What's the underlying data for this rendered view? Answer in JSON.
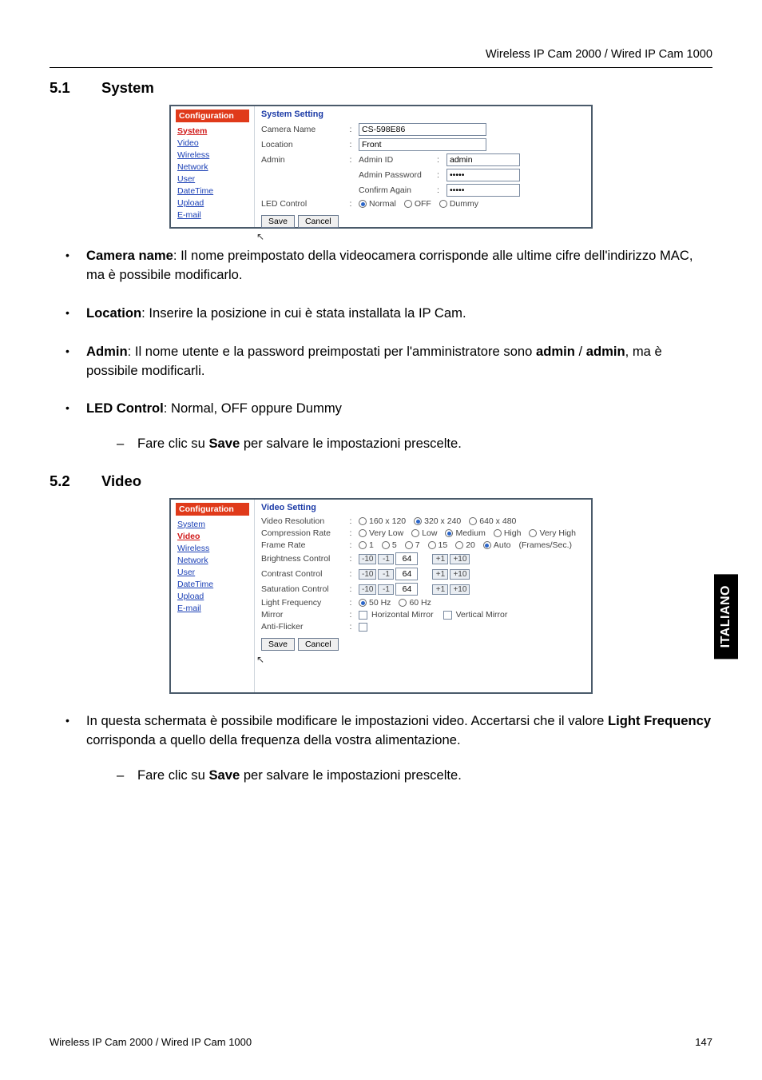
{
  "header": {
    "product_line": "Wireless IP Cam 2000 / Wired IP Cam 1000"
  },
  "side_tab": "ITALIANO",
  "section1": {
    "num": "5.1",
    "title": "System"
  },
  "section2": {
    "num": "5.2",
    "title": "Video"
  },
  "s1": {
    "nav_header": "Configuration",
    "nav": {
      "system": "System",
      "video": "Video",
      "wireless": "Wireless",
      "network": "Network",
      "user": "User",
      "datetime": "DateTime",
      "upload": "Upload",
      "email": "E-mail"
    },
    "pane_header": "System Setting",
    "cam_name_label": "Camera Name",
    "cam_name_value": "CS-598E86",
    "location_label": "Location",
    "location_value": "Front",
    "admin_label": "Admin",
    "admin_id_label": "Admin ID",
    "admin_id_value": "admin",
    "admin_pw_label": "Admin Password",
    "admin_pw_value": "•••••",
    "confirm_label": "Confirm Again",
    "confirm_value": "•••••",
    "led_label": "LED Control",
    "led_opts": {
      "normal": "Normal",
      "off": "OFF",
      "dummy": "Dummy"
    },
    "save": "Save",
    "cancel": "Cancel",
    "colon": ":"
  },
  "s2": {
    "nav_header": "Configuration",
    "nav": {
      "system": "System",
      "video": "Video",
      "wireless": "Wireless",
      "network": "Network",
      "user": "User",
      "datetime": "DateTime",
      "upload": "Upload",
      "email": "E-mail"
    },
    "pane_header": "Video Setting",
    "res_label": "Video Resolution",
    "res_opts": {
      "r1": "160 x 120",
      "r2": "320 x 240",
      "r3": "640 x 480"
    },
    "comp_label": "Compression Rate",
    "comp_opts": {
      "c1": "Very Low",
      "c2": "Low",
      "c3": "Medium",
      "c4": "High",
      "c5": "Very High"
    },
    "fr_label": "Frame Rate",
    "fr_opts": {
      "f1": "1",
      "f5": "5",
      "f7": "7",
      "f15": "15",
      "f20": "20",
      "auto": "Auto"
    },
    "fr_suffix": "(Frames/Sec.)",
    "bright_label": "Brightness Control",
    "contrast_label": "Contrast Control",
    "sat_label": "Saturation Control",
    "step": {
      "m10": "-10",
      "m1": "-1",
      "val": "64",
      "p1": "+1",
      "p10": "+10"
    },
    "lf_label": "Light Frequency",
    "lf_opts": {
      "l50": "50 Hz",
      "l60": "60 Hz"
    },
    "mirror_label": "Mirror",
    "mirror_opts": {
      "h": "Horizontal Mirror",
      "v": "Vertical Mirror"
    },
    "af_label": "Anti-Flicker",
    "save": "Save",
    "cancel": "Cancel",
    "colon": ":"
  },
  "body": {
    "b1_a": "Camera name",
    "b1_b": ": Il nome preimpostato della videocamera corrisponde alle ultime cifre dell'indirizzo MAC, ma è possibile modificarlo.",
    "b2_a": "Location",
    "b2_b": ": Inserire la posizione in cui è stata installata la IP Cam.",
    "b3_a": "Admin",
    "b3_b": ": Il nome utente e la password preimpostati per l'amministratore sono ",
    "b3_c": "admin",
    "b3_d": " / ",
    "b3_e": "admin",
    "b3_f": ",  ma è possibile modificarli.",
    "b4_a": "LED Control",
    "b4_b": ": Normal, OFF oppure Dummy",
    "b4_sub_a": "Fare clic su ",
    "b4_sub_b": "Save",
    "b4_sub_c": " per salvare le impostazioni prescelte.",
    "b5_a": "In questa schermata è possibile modificare le impostazioni video. Accertarsi che il valore ",
    "b5_b": "Light Frequency",
    "b5_c": " corrisponda a quello della frequenza della vostra alimentazione.",
    "b5_sub_a": "Fare clic su ",
    "b5_sub_b": "Save",
    "b5_sub_c": " per salvare le impostazioni prescelte."
  },
  "footer": {
    "left": "Wireless IP Cam 2000 / Wired IP Cam 1000",
    "right": "147"
  }
}
